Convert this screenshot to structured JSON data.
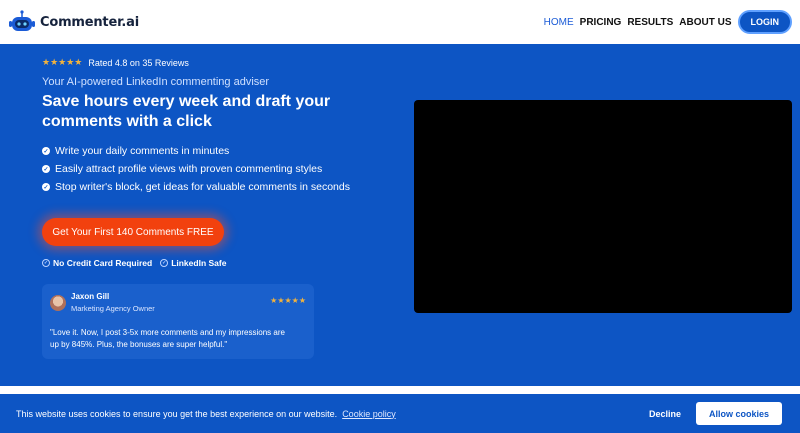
{
  "header": {
    "logo_text": "Commenter.ai",
    "nav": [
      {
        "label": "HOME",
        "active": true
      },
      {
        "label": "PRICING"
      },
      {
        "label": "RESULTS"
      },
      {
        "label": "ABOUT US"
      }
    ],
    "login_label": "LOGIN"
  },
  "hero": {
    "stars": "★★★★★",
    "rating_text": "Rated 4.8 on 35 Reviews",
    "subtitle": "Your AI-powered LinkedIn commenting adviser",
    "headline": "Save hours every week and draft your comments with a click",
    "features": [
      "Write your daily comments in minutes",
      "Easily attract profile views with proven commenting styles",
      "Stop writer's block, get ideas for valuable comments in seconds"
    ],
    "cta_label": "Get Your First 140 Comments FREE",
    "trust": [
      "No Credit Card Required",
      "LinkedIn Safe"
    ]
  },
  "testimonial": {
    "name": "Jaxon Gill",
    "role": "Marketing Agency Owner",
    "stars": "★★★★★",
    "quote": "\"Love it. Now, I post 3-5x more comments and my impressions are up by 845%. Plus, the bonuses are super helpful.\""
  },
  "cookie": {
    "text": "This website uses cookies to ensure you get the best experience on our website.",
    "link": "Cookie policy",
    "decline_label": "Decline",
    "allow_label": "Allow cookies"
  },
  "colors": {
    "brand_blue": "#0d55c4",
    "cta_orange": "#f2410e",
    "star_gold": "#f2b33d"
  }
}
